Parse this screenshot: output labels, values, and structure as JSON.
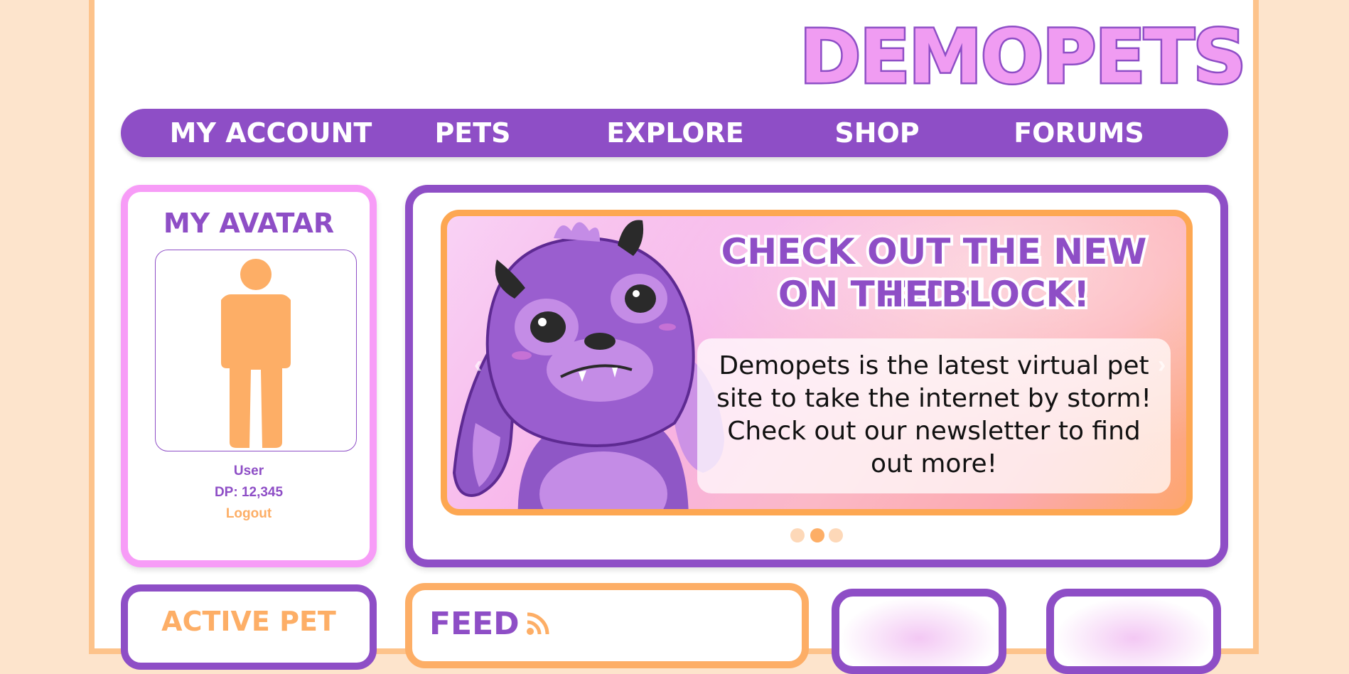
{
  "logo": "DEMOPETS",
  "nav": [
    "MY ACCOUNT",
    "PETS",
    "EXPLORE",
    "SHOP",
    "FORUMS"
  ],
  "avatar_panel": {
    "title": "MY AVATAR",
    "username": "User",
    "dp": "DP: 12,345",
    "logout": "Logout"
  },
  "banner": {
    "headline_line1": "CHECK OUT THE NEW KIDH",
    "headline_line2": "ON THE BLOCK!",
    "blurb_line1": "Demopets is the latest virtual pet",
    "blurb_line2": "site to take the internet by storm!",
    "blurb_line3": "Check out our newsletter to find",
    "blurb_line4": "out more!",
    "active_slide": 2,
    "slide_count": 3
  },
  "active_pet": {
    "title": "ACTIVE PET"
  },
  "feed": {
    "title": "FEED"
  },
  "colors": {
    "purple": "#8e4ec6",
    "pink": "#f79cf7",
    "orange": "#fdae66",
    "background": "#fde4cc"
  }
}
